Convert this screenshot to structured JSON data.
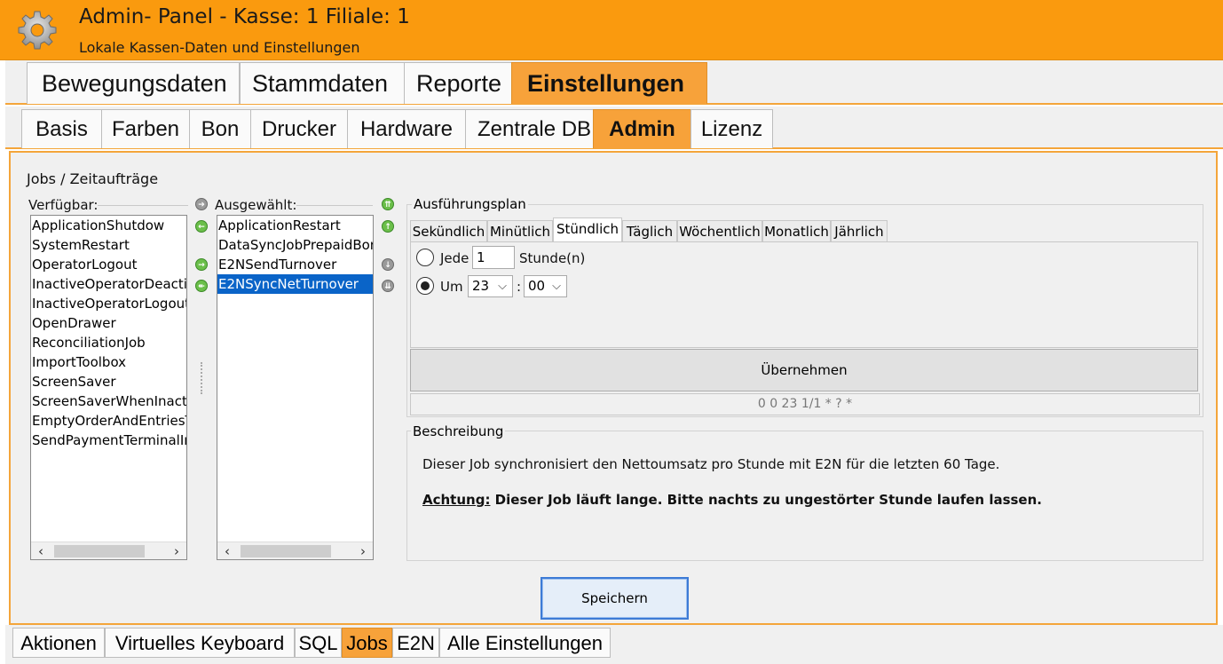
{
  "header": {
    "title": "Admin- Panel - Kasse: 1 Filiale: 1",
    "subtitle": "Lokale Kassen-Daten und Einstellungen",
    "accent_color": "#fa9a0e",
    "icon": "gear-icon"
  },
  "main_tabs": [
    "Bewegungsdaten",
    "Stammdaten",
    "Reporte",
    "Einstellungen"
  ],
  "main_tab_active": "Einstellungen",
  "sub_tabs": [
    "Basis",
    "Farben",
    "Bon",
    "Drucker",
    "Hardware",
    "Zentrale DB",
    "Admin",
    "Lizenz"
  ],
  "sub_tab_active": "Admin",
  "section_title": "Jobs / Zeitaufträge",
  "available": {
    "label": "Verfügbar:",
    "items": [
      "ApplicationShutdow",
      "SystemRestart",
      "OperatorLogout",
      "InactiveOperatorDeactiva",
      "InactiveOperatorLogout",
      "OpenDrawer",
      "ReconciliationJob",
      "ImportToolbox",
      "ScreenSaver",
      "ScreenSaverWhenInactiv",
      "EmptyOrderAndEntriesT",
      "SendPaymentTerminalIn"
    ]
  },
  "selected": {
    "label": "Ausgewählt:",
    "items": [
      "ApplicationRestart",
      "DataSyncJobPrepaidBonu",
      "E2NSendTurnover",
      "E2NSyncNetTurnover"
    ],
    "selected_item": "E2NSyncNetTurnover"
  },
  "schedule": {
    "legend": "Ausführungsplan",
    "tabs": [
      "Sekündlich",
      "Minütlich",
      "Stündlich",
      "Täglich",
      "Wöchentlich",
      "Monatlich",
      "Jährlich"
    ],
    "active_tab": "Stündlich",
    "every_label": "Jede",
    "every_value": "1",
    "every_unit": "Stunde(n)",
    "at_label": "Um",
    "hour_value": "23",
    "colon": ":",
    "minute_value": "00",
    "selected_option": "Um",
    "apply_button": "Übernehmen",
    "cron": "0 0 23 1/1 * ? *"
  },
  "description": {
    "legend": "Beschreibung",
    "text": "Dieser Job synchronisiert den Nettoumsatz pro Stunde mit E2N für die letzten 60 Tage.",
    "warning_label": "Achtung:",
    "warning_text": " Dieser Job läuft lange. Bitte nachts zu ungestörter Stunde laufen lassen."
  },
  "save_button": "Speichern",
  "bottom_tabs": [
    "Aktionen",
    "Virtuelles Keyboard",
    "SQL",
    "Jobs",
    "E2N",
    "Alle Einstellungen"
  ],
  "bottom_tab_active": "Jobs"
}
